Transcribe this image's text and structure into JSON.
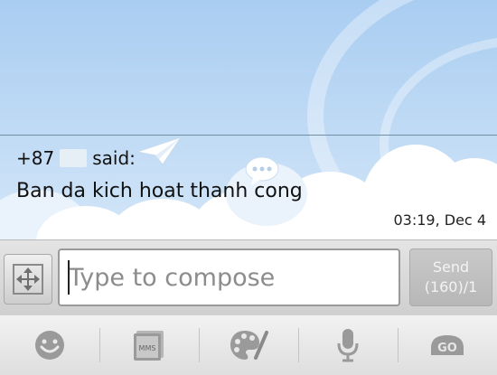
{
  "message": {
    "sender_prefix": "+87",
    "said_label": "said:",
    "body": "Ban da kich hoat thanh cong",
    "timestamp": "03:19, Dec 4"
  },
  "compose": {
    "placeholder": "Type to compose",
    "send_label": "Send",
    "char_counter": "(160)/1"
  },
  "toolbar": {
    "items": [
      {
        "icon": "emoji-icon"
      },
      {
        "icon": "mms-icon",
        "label": "MMS"
      },
      {
        "icon": "palette-icon"
      },
      {
        "icon": "microphone-icon"
      },
      {
        "icon": "go-icon",
        "label": "GO"
      }
    ]
  },
  "colors": {
    "sky_top": "#a9cdf1",
    "sky_bottom": "#d3e6f8",
    "icon_gray": "#9a9a9a"
  }
}
